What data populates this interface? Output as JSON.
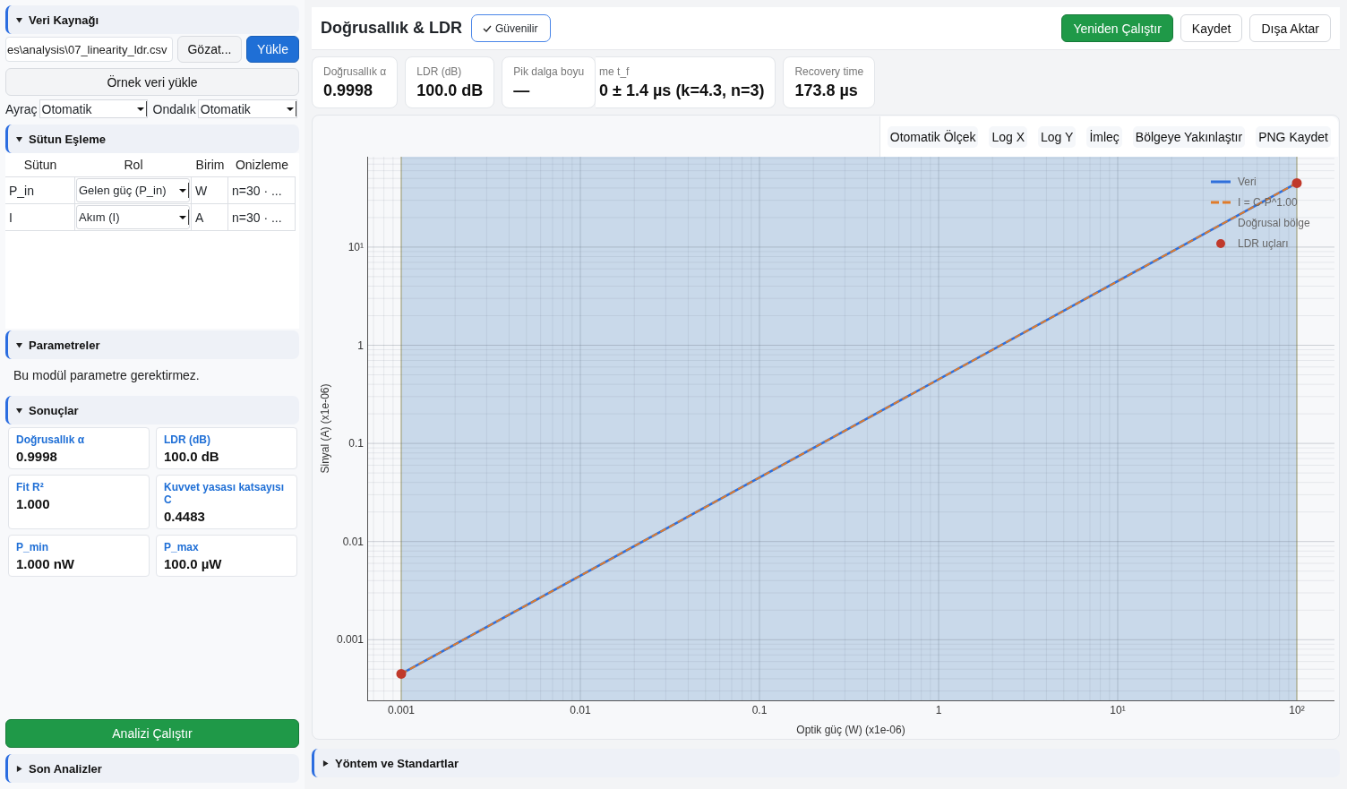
{
  "sidebar": {
    "data_source": {
      "title": "Veri Kaynağı",
      "expanded": true,
      "file_path": "es\\analysis\\07_linearity_ldr.csv",
      "browse_button": "Gözat...",
      "load_button": "Yükle",
      "sample_button": "Örnek veri yükle",
      "separator": {
        "label": "Ayraç",
        "value": "Otomatik"
      },
      "decimal": {
        "label": "Ondalık",
        "value": "Otomatik"
      }
    },
    "column_mapping": {
      "title": "Sütun Eşleme",
      "expanded": true,
      "columns": [
        "Sütun",
        "Rol",
        "Birim",
        "Onizleme"
      ],
      "rows": [
        {
          "column": "P_in",
          "role": "Gelen güç (P_in)",
          "unit": "W",
          "preview": "n=30 · ..."
        },
        {
          "column": "I",
          "role": "Akım (I)",
          "unit": "A",
          "preview": "n=30 · ..."
        }
      ]
    },
    "parameters": {
      "title": "Parametreler",
      "expanded": true,
      "note": "Bu modül parametre gerektirmez."
    },
    "results": {
      "title": "Sonuçlar",
      "expanded": true,
      "cards": [
        {
          "label": "Doğrusallık α",
          "value": "0.9998"
        },
        {
          "label": "LDR (dB)",
          "value": "100.0 dB"
        },
        {
          "label": "Fit R²",
          "value": "1.000"
        },
        {
          "label": "Kuvvet yasası katsayısı C",
          "value": "0.4483"
        },
        {
          "label": "P_min",
          "value": "1.000 nW"
        },
        {
          "label": "P_max",
          "value": "100.0 µW"
        }
      ]
    },
    "run_button": "Analizi Çalıştır",
    "recent": {
      "title": "Son Analizler",
      "expanded": false
    }
  },
  "header": {
    "title": "Doğrusallık & LDR",
    "badge": "Güvenilir",
    "buttons": [
      {
        "kind": "rerun",
        "label": "Yeniden Çalıştır"
      },
      {
        "kind": "save",
        "label": "Kaydet"
      },
      {
        "kind": "export",
        "label": "Dışa Aktar"
      }
    ]
  },
  "kpis": [
    {
      "kind": "full",
      "label": "Doğrusallık α",
      "value": "0.9998"
    },
    {
      "kind": "full",
      "label": "LDR (dB)",
      "value": "100.0 dB"
    },
    {
      "kind": "full",
      "label": "Pik dalga boyu",
      "value": "—"
    },
    {
      "kind": "partial",
      "label": "me t_f",
      "value": "0 ± 1.4 µs (k=4.3, n=3)"
    },
    {
      "kind": "full",
      "label": "Recovery time",
      "value": "173.8 µs"
    }
  ],
  "chart": {
    "toolbar": [
      "Otomatik Ölçek",
      "Log X",
      "Log Y",
      "İmleç",
      "Bölgeye Yakınlaştır",
      "PNG Kaydet"
    ],
    "y_ticks": [
      "10¹",
      "1",
      "0.1",
      "0.01",
      "0.001"
    ],
    "ylabel": "Sinyal (A) (x1e-06)",
    "x_ticks": [
      "0.001",
      "0.01",
      "0.1",
      "1",
      "10¹",
      "10²"
    ],
    "xlabel": "Optik güç (W) (x1e-06)",
    "legend": [
      {
        "kind": "line",
        "label": "Veri",
        "color": "#2f6fdb"
      },
      {
        "kind": "dashed",
        "label": "I = C·P^1.00",
        "color": "#e07b2a"
      },
      {
        "kind": "band",
        "label": "Doğrusal bölge",
        "color": "#c9d9ea"
      },
      {
        "kind": "dot",
        "label": "LDR uçları",
        "color": "#c0392b"
      }
    ]
  },
  "methods": {
    "title": "Yöntem ve Standartlar",
    "expanded": false
  }
}
